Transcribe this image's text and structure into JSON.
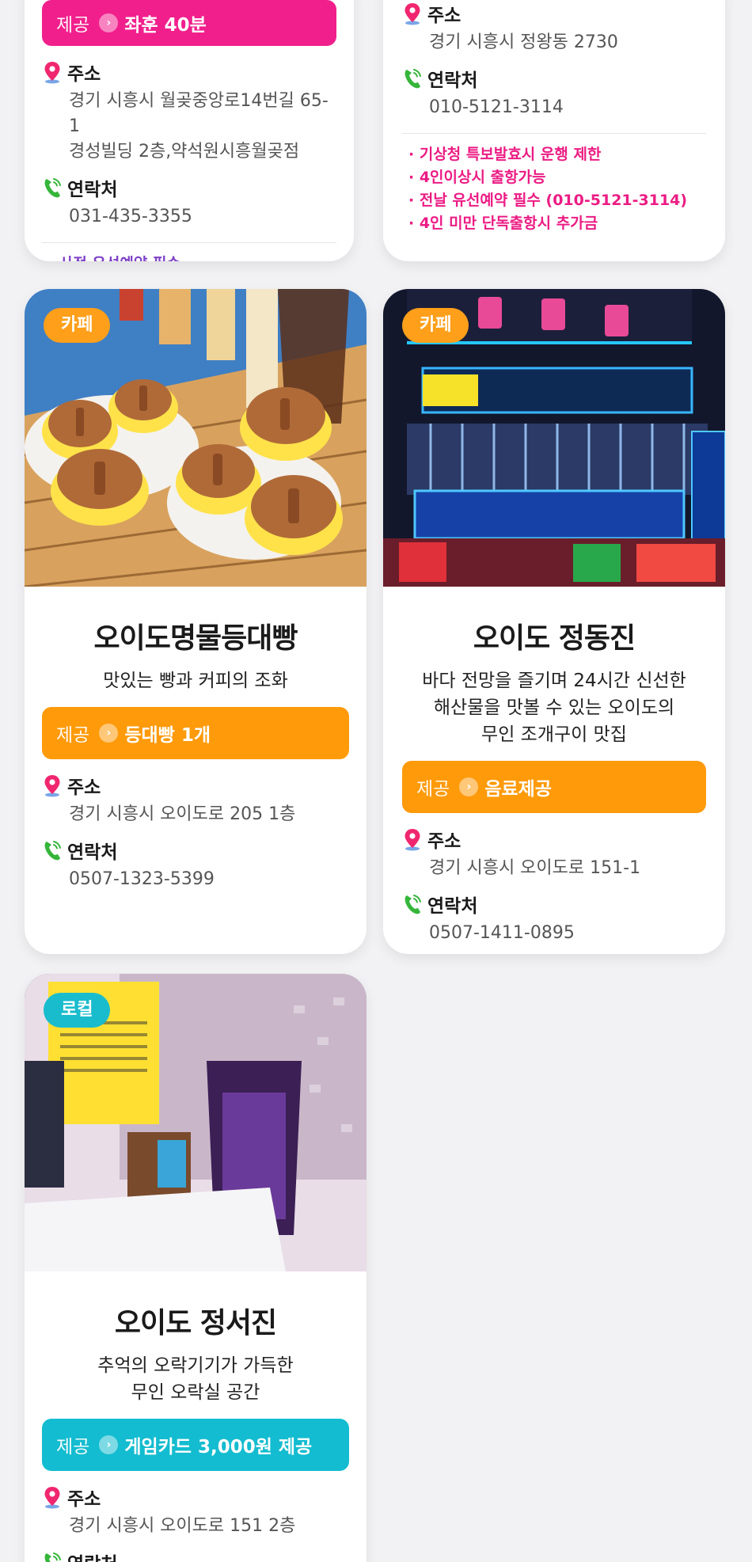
{
  "colors": {
    "background": "#f2f2f4",
    "pink": "#f11f8c",
    "orange": "#ff9a0a",
    "teal": "#13bcd0",
    "note_pink": "#ec1c84",
    "note_purple": "#7e3fc8"
  },
  "labels": {
    "offer": "제공",
    "address": "주소",
    "contact": "연락처"
  },
  "cards": [
    {
      "offer": "좌훈 40분",
      "address": "경기 시흥시 월곶중앙로14번길 65-1\n경성빌딩 2층,약석원시흥월곶점",
      "contact": "031-435-3355",
      "notes": [
        "· 사전 유선예약 필수"
      ]
    },
    {
      "address": "경기 시흥시 정왕동 2730",
      "contact": "010-5121-3114",
      "notes": [
        "· 기상청 특보발효시 운행 제한",
        "· 4인이상시 출항가능",
        "· 전날 유선예약 필수 (010-5121-3114)",
        "· 4인 미만 단독출항시 추가금"
      ]
    },
    {
      "tag": "카페",
      "image": "muffins-cafe-photo",
      "title": "오이도명물등대빵",
      "subtitle": "맛있는 빵과 커피의 조화",
      "offer": "등대빵 1개",
      "address": "경기 시흥시 오이도로 205 1층",
      "contact": "0507-1323-5399"
    },
    {
      "tag": "카페",
      "image": "neon-storefront-photo",
      "title": "오이도 정동진",
      "subtitle": "바다 전망을 즐기며 24시간 신선한\n해산물을 맛볼 수 있는 오이도의\n무인 조개구이 맛집",
      "offer": "음료제공",
      "address": "경기 시흥시 오이도로 151-1",
      "contact": "0507-1411-0895"
    },
    {
      "tag": "로컬",
      "image": "arcade-room-photo",
      "title": "오이도 정서진",
      "subtitle": "추억의 오락기기가 가득한\n무인 오락실 공간",
      "offer": "게임카드 3,000원 제공",
      "address": "경기 시흥시 오이도로 151 2층"
    }
  ],
  "icons": {
    "pin": "map-pin-icon",
    "phone": "phone-icon",
    "arrow": "chevron-right-icon"
  }
}
